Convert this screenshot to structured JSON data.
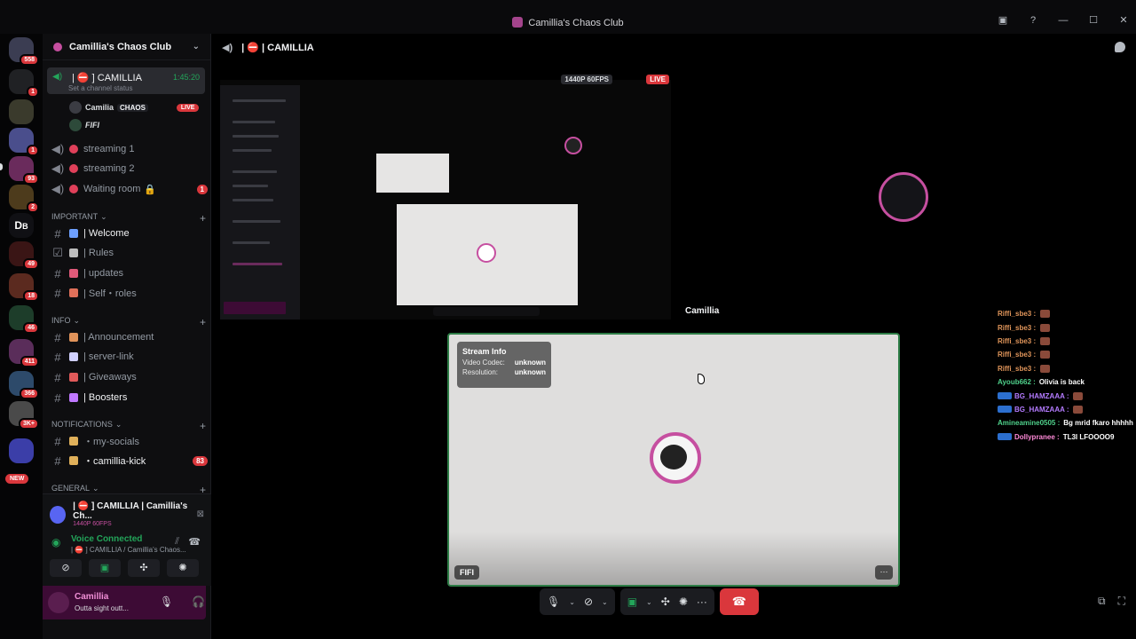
{
  "window": {
    "title": "Camillia's Chaos Club"
  },
  "rail": {
    "badges": [
      "558",
      "1",
      "1",
      "93",
      "2",
      "49",
      "18",
      "46",
      "411",
      "366",
      "3K+"
    ],
    "new_label": "NEW"
  },
  "guild": {
    "name": "Camillia's Chaos Club"
  },
  "voice": {
    "active_channel": "| ⛔ ] CAMILLIA",
    "duration": "1:45:20",
    "status_placeholder": "Set a channel status",
    "users": [
      {
        "name": "Camilia",
        "tag": "CHAOS",
        "live": "LIVE"
      },
      {
        "name": "FIFI"
      }
    ],
    "channels": [
      {
        "name": "streaming 1"
      },
      {
        "name": "streaming 2"
      },
      {
        "name": "Waiting room",
        "badge": "1"
      }
    ]
  },
  "categories": [
    {
      "name": "IMPORTANT",
      "channels": [
        {
          "name": "| Welcome",
          "color": "#6ea0ff"
        },
        {
          "name": "| Rules",
          "color": "#bdbdbd"
        },
        {
          "name": "| updates",
          "color": "#e05a7a"
        },
        {
          "name": "| Self・roles",
          "color": "#e0705a"
        }
      ]
    },
    {
      "name": "INFO",
      "channels": [
        {
          "name": "| Announcement",
          "color": "#e0935a"
        },
        {
          "name": "| server-link",
          "color": "#d0d0ff"
        },
        {
          "name": "| Giveaways",
          "color": "#e05a5a"
        },
        {
          "name": "| Boosters",
          "color": "#c078ff"
        }
      ]
    },
    {
      "name": "NOTIFICATIONS",
      "channels": [
        {
          "name": "・my-socials",
          "color": "#e0b05a"
        },
        {
          "name": "・camillia-kick",
          "color": "#e0b05a",
          "badge": "83"
        }
      ]
    },
    {
      "name": "GENERAL",
      "channels": []
    }
  ],
  "stream_panel": {
    "title": "| ⛔ ] CAMILLIA | Camillia's Ch...",
    "quality": "1440P 60FPS"
  },
  "voice_connected": {
    "title": "Voice Connected",
    "subtitle": "| ⛔ ] CAMILLIA / Camillia's Chaos..."
  },
  "user_panel": {
    "name": "Camillia",
    "status": "Outta sight outt..."
  },
  "main": {
    "channel_title": "| ⛔ | CAMILLIA",
    "share_quality": "1440P 60FPS",
    "share_live": "LIVE",
    "cam_name": "Camillia",
    "focus_name": "FIFI",
    "stream_info": {
      "title": "Stream Info",
      "codec_label": "Video Codec:",
      "codec_value": "unknown",
      "res_label": "Resolution:",
      "res_value": "unknown"
    }
  },
  "chat": [
    {
      "author": "Riffi_sbe3 :",
      "color": "#e0955a",
      "text": "",
      "emote": true
    },
    {
      "author": "Riffi_sbe3 :",
      "color": "#e0955a",
      "text": "",
      "emote": true
    },
    {
      "author": "Riffi_sbe3 :",
      "color": "#e0955a",
      "text": "",
      "emote": true
    },
    {
      "author": "Riffi_sbe3 :",
      "color": "#e0955a",
      "text": "",
      "emote": true
    },
    {
      "author": "Riffi_sbe3 :",
      "color": "#e0955a",
      "text": "",
      "emote": true
    },
    {
      "author": "Ayoub662 :",
      "color": "#4fd18b",
      "text": "Olivia is back"
    },
    {
      "author": "BG_HAMZAAA :",
      "color": "#b47bff",
      "text": "",
      "emote": true,
      "pre": true
    },
    {
      "author": "BG_HAMZAAA :",
      "color": "#b47bff",
      "text": "",
      "emote": true,
      "pre": true
    },
    {
      "author": "Amineamine0505 :",
      "color": "#4fd18b",
      "text": "Bg mrid fkaro hhhhh"
    },
    {
      "author": "Dollypranee :",
      "color": "#ff8ad8",
      "text": "TL3I LFOOOO9",
      "pre": true
    }
  ]
}
